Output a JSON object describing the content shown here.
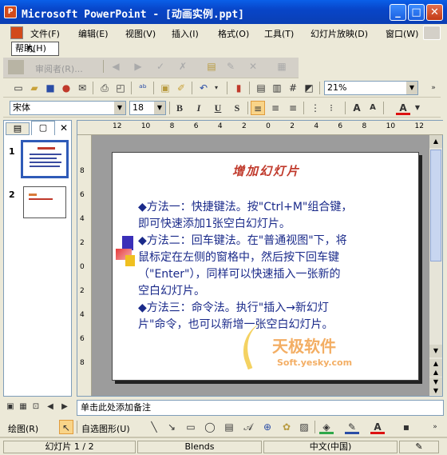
{
  "window": {
    "title": "Microsoft PowerPoint - [动画实例.ppt]",
    "app_icon": "P"
  },
  "menu": [
    "文件(F)",
    "编辑(E)",
    "视图(V)",
    "插入(I)",
    "格式(O)",
    "工具(T)",
    "幻灯片放映(D)",
    "窗口(W)"
  ],
  "help_popup": "帮助(H)",
  "review_toolbar": {
    "reviewer": "审阅者(R)..."
  },
  "format": {
    "font": "宋体",
    "size": "18",
    "zoom": "21%",
    "bold": "B",
    "italic": "I",
    "underline": "U",
    "shadow": "S",
    "bigger": "A",
    "smaller": "A",
    "font_color": "A"
  },
  "thumbnails": [
    {
      "num": "1"
    },
    {
      "num": "2"
    }
  ],
  "slide": {
    "title": "增加幻灯片",
    "lines": [
      "◆方法一：快捷键法。按\"Ctrl+M\"组合键，",
      "即可快速添加1张空白幻灯片。",
      "◆方法二：回车键法。在\"普通视图\"下，将",
      "鼠标定在左侧的窗格中，然后按下回车键",
      "（\"Enter\"），同样可以快速插入一张新的",
      "空白幻灯片。",
      " ◆方法三：命令法。执行\"插入→新幻灯",
      "片\"命令，也可以新增一张空白幻灯片。"
    ],
    "watermark": "天极软件",
    "watermark_url": "Soft.yesky.com"
  },
  "ruler_numbers": [
    "12",
    "10",
    "8",
    "6",
    "4",
    "2",
    "0",
    "2",
    "4",
    "6",
    "8",
    "10",
    "12"
  ],
  "vruler_numbers": [
    "8",
    "6",
    "4",
    "2",
    "0",
    "2",
    "4",
    "6",
    "8"
  ],
  "notes_placeholder": "单击此处添加备注",
  "draw": {
    "draw_label": "绘图(R)",
    "autoshapes": "自选图形(U)"
  },
  "status": {
    "slide": "幻灯片 1 / 2",
    "design": "Blends",
    "lang": "中文(中国)"
  },
  "colors": {
    "title_bar": "#0845c8",
    "slide_title": "#c0392b",
    "slide_text": "#1a2a8a"
  }
}
